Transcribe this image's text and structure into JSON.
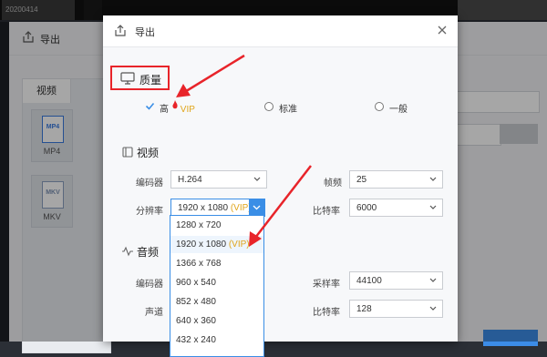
{
  "background": {
    "top_title": "20200414",
    "window_title": "导出",
    "format_tab": "视频",
    "formats": [
      "MP4",
      "MKV"
    ]
  },
  "dialog": {
    "title": "导出",
    "quality": {
      "section_title": "质量",
      "options": [
        {
          "label": "高",
          "vip": "VIP",
          "checked": true
        },
        {
          "label": "标准",
          "checked": false
        },
        {
          "label": "一般",
          "checked": false
        }
      ]
    },
    "video": {
      "section_title": "视频",
      "encoder_label": "编码器",
      "encoder_value": "H.264",
      "framerate_label": "帧频",
      "framerate_value": "25",
      "resolution_label": "分辨率",
      "resolution_value": "1920 x 1080",
      "resolution_vip": "(VIP)",
      "bitrate_label": "比特率",
      "bitrate_value": "6000",
      "resolution_options": [
        {
          "label": "1280 x 720",
          "vip": ""
        },
        {
          "label": "1920 x 1080",
          "vip": "(VIP)"
        },
        {
          "label": "1366 x 768",
          "vip": ""
        },
        {
          "label": "960 x 540",
          "vip": ""
        },
        {
          "label": "852 x 480",
          "vip": ""
        },
        {
          "label": "640 x 360",
          "vip": ""
        },
        {
          "label": "432 x 240",
          "vip": ""
        }
      ]
    },
    "audio": {
      "section_title": "音频",
      "encoder_label": "编码器",
      "samplerate_label": "采样率",
      "samplerate_value": "44100",
      "channel_label": "声道",
      "bitrate_label": "比特率",
      "bitrate_value": "128"
    }
  },
  "colors": {
    "accent": "#3a8ee6",
    "annotation_red": "#e8242a",
    "vip": "#e0a51a"
  }
}
